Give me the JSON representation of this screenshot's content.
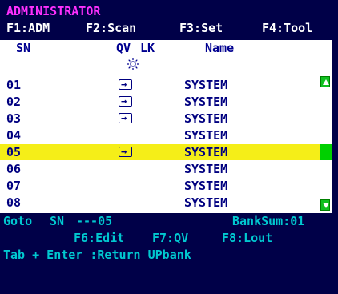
{
  "title": "ADMINISTRATOR",
  "fkeys": {
    "f1": "F1:ADM",
    "f2": "F2:Scan",
    "f3": "F3:Set",
    "f4": "F4:Tool"
  },
  "columns": {
    "sn": "SN",
    "brightness_icon": "sun-icon",
    "qv": "QV",
    "lk": "LK",
    "name": "Name"
  },
  "rows": [
    {
      "sn": "01",
      "qv": true,
      "name": "SYSTEM"
    },
    {
      "sn": "02",
      "qv": true,
      "name": "SYSTEM"
    },
    {
      "sn": "03",
      "qv": true,
      "name": "SYSTEM"
    },
    {
      "sn": "04",
      "qv": false,
      "name": "SYSTEM"
    },
    {
      "sn": "05",
      "qv": true,
      "name": "SYSTEM",
      "selected": true
    },
    {
      "sn": "06",
      "qv": false,
      "name": "SYSTEM"
    },
    {
      "sn": "07",
      "qv": false,
      "name": "SYSTEM"
    },
    {
      "sn": "08",
      "qv": false,
      "name": "SYSTEM"
    }
  ],
  "footer": {
    "goto_label": "Goto",
    "sn_label": "SN",
    "sn_value": "---05",
    "banksum": "BankSum:01",
    "f6": "F6:Edit",
    "f7": "F7:QV",
    "f8": "F8:Lout",
    "hint": "Tab + Enter :Return UPbank"
  },
  "colors": {
    "background": "#000048",
    "selection": "#f5ee18",
    "title": "#ff30ff",
    "footer_text": "#00c8d0"
  }
}
